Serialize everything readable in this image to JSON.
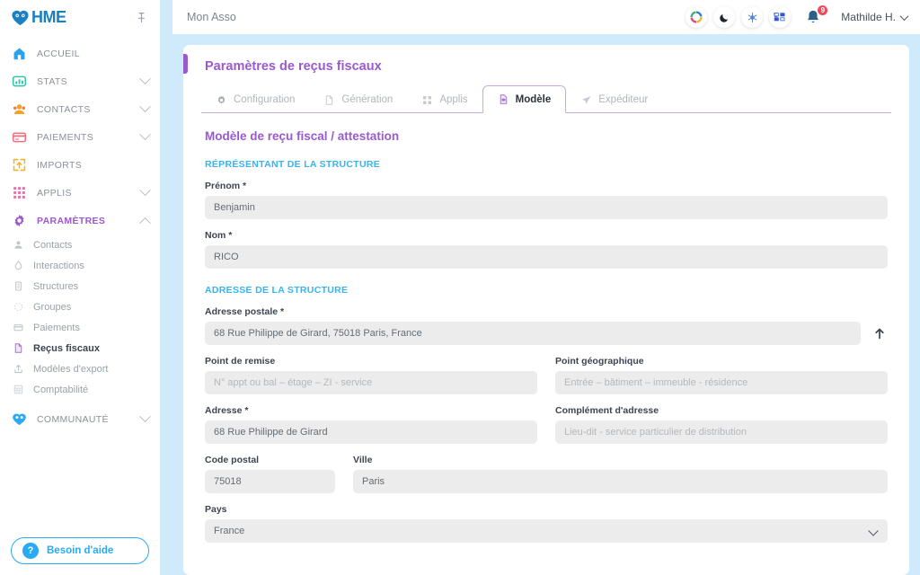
{
  "brand": {
    "logo_text": "HME",
    "logo_icon": "heart-logo-icon",
    "pin_icon": "pin-icon"
  },
  "sidebar": {
    "items": [
      {
        "label": "ACCUEIL",
        "icon": "home-icon",
        "expandable": false,
        "active": false
      },
      {
        "label": "STATS",
        "icon": "stats-icon",
        "expandable": true,
        "active": false
      },
      {
        "label": "CONTACTS",
        "icon": "contacts-icon",
        "expandable": true,
        "active": false
      },
      {
        "label": "PAIEMENTS",
        "icon": "credit-card-icon",
        "expandable": true,
        "active": false
      },
      {
        "label": "IMPORTS",
        "icon": "import-icon",
        "expandable": false,
        "active": false
      },
      {
        "label": "APPLIS",
        "icon": "apps-grid-icon",
        "expandable": true,
        "active": false
      },
      {
        "label": "PARAMÈTRES",
        "icon": "gear-icon",
        "expandable": true,
        "active": true
      }
    ],
    "settings_sub_items": [
      {
        "label": "Contacts",
        "icon": "contacts-sub-icon",
        "active": false
      },
      {
        "label": "Interactions",
        "icon": "drop-icon",
        "active": false
      },
      {
        "label": "Structures",
        "icon": "building-icon",
        "active": false
      },
      {
        "label": "Groupes",
        "icon": "groups-icon",
        "active": false
      },
      {
        "label": "Paiements",
        "icon": "card-sub-icon",
        "active": false
      },
      {
        "label": "Reçus fiscaux",
        "icon": "document-icon",
        "active": true
      },
      {
        "label": "Modèles d'export",
        "icon": "export-icon",
        "active": false
      },
      {
        "label": "Comptabilité",
        "icon": "accounting-icon",
        "active": false
      }
    ],
    "community": {
      "label": "COMMUNAUTÉ",
      "icon": "community-heart-icon",
      "expandable": true
    },
    "help_button": {
      "label": "Besoin d'aide",
      "icon": "question-mark-icon"
    }
  },
  "topbar": {
    "app_title": "Mon Asso",
    "icons": [
      {
        "name": "color-wheel-icon"
      },
      {
        "name": "moon-icon"
      },
      {
        "name": "snowflake-icon"
      },
      {
        "name": "keyboard-shortcut-icon"
      }
    ],
    "notifications": {
      "icon": "bell-icon",
      "count": "9"
    },
    "user": {
      "name": "Mathilde H.",
      "chevron": "chevron-down-icon"
    }
  },
  "page": {
    "title": "Paramètres de reçus fiscaux",
    "tabs": [
      {
        "label": "Configuration",
        "icon": "gear-tab-icon",
        "active": false
      },
      {
        "label": "Génération",
        "icon": "document-tab-icon",
        "active": false
      },
      {
        "label": "Applis",
        "icon": "grid-tab-icon",
        "active": false
      },
      {
        "label": "Modèle",
        "icon": "template-tab-icon",
        "active": true
      },
      {
        "label": "Expéditeur",
        "icon": "send-tab-icon",
        "active": false
      }
    ],
    "section_title": "Modèle de reçu fiscal / attestation",
    "representative": {
      "heading": "RÉPRÉSENTANT DE LA STRUCTURE",
      "first_name": {
        "label": "Prénom *",
        "value": "Benjamin"
      },
      "last_name": {
        "label": "Nom *",
        "value": "RICO"
      }
    },
    "address": {
      "heading": "ADRESSE DE LA STRUCTURE",
      "postal_address": {
        "label": "Adresse postale *",
        "value": "68 Rue Philippe de Girard, 75018 Paris, France",
        "action_icon": "up-arrow-icon"
      },
      "delivery_point": {
        "label": "Point de remise",
        "value": "",
        "placeholder": "N° appt ou bal – étage – ZI - service"
      },
      "geographic_point": {
        "label": "Point géographique",
        "value": "",
        "placeholder": "Entrée – bâtiment – immeuble - résidence"
      },
      "street": {
        "label": "Adresse *",
        "value": "68 Rue Philippe de Girard"
      },
      "complement": {
        "label": "Complément d'adresse",
        "value": "",
        "placeholder": "Lieu-dit - service particulier de distribution"
      },
      "postal_code": {
        "label": "Code postal",
        "value": "75018"
      },
      "city": {
        "label": "Ville",
        "value": "Paris"
      },
      "country": {
        "label": "Pays",
        "value": "France",
        "chevron": "chevron-down-icon"
      }
    }
  },
  "colors": {
    "purple": "#9b59d0",
    "blue_accent": "#35b4f5",
    "help_blue": "#29aaf2",
    "badge_red": "#ef4a5a",
    "field_bg": "#ececec",
    "gutter_blue": "#cfeafb"
  }
}
